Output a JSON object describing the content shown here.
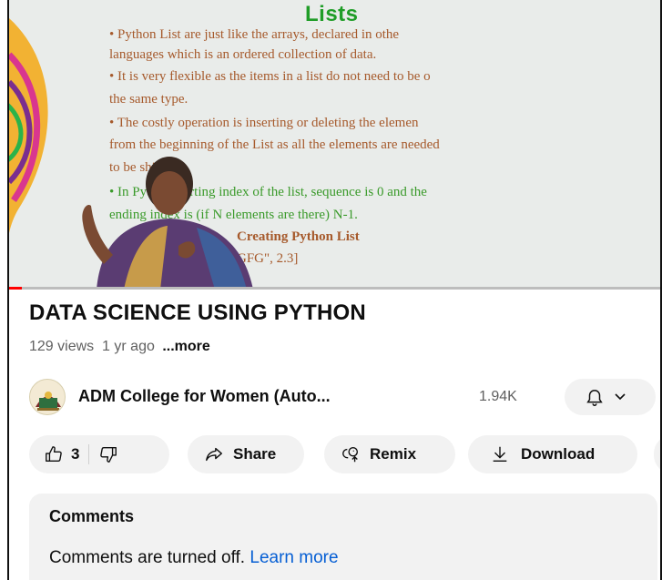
{
  "video": {
    "slide_title": "Lists",
    "slide_lines": [
      "•   Python List are just like the arrays, declared in othe",
      "languages which is an ordered collection of data.",
      "•   It is very flexible as the items in a list do not need to be o",
      "the same type.",
      "•   The costly operation is inserting or deleting the elemen",
      "from the beginning of the List as all the elements are needed",
      "to be shifted.",
      "•   In Python starting index of the list, sequence is 0 and the",
      "ending index is (if N elements are there) N-1.",
      "Creating Python List",
      "GFG\", 2.3]"
    ],
    "progress_fraction": 0.02
  },
  "title": "DATA SCIENCE USING PYTHON",
  "meta": {
    "views": "129 views",
    "age": "1 yr ago",
    "more": "...more"
  },
  "channel": {
    "name": "ADM College for Women (Auto...",
    "subscribers": "1.94K"
  },
  "actions": {
    "like_count": "3",
    "share": "Share",
    "remix": "Remix",
    "download": "Download"
  },
  "comments": {
    "heading": "Comments",
    "text": "Comments are turned off. ",
    "link": "Learn more"
  },
  "colors": {
    "slide_title": "#1f9d27",
    "slide_brown": "#a65a2c",
    "slide_green": "#3a9a2a",
    "link": "#065fd4",
    "pill_bg": "#f2f2f2"
  }
}
